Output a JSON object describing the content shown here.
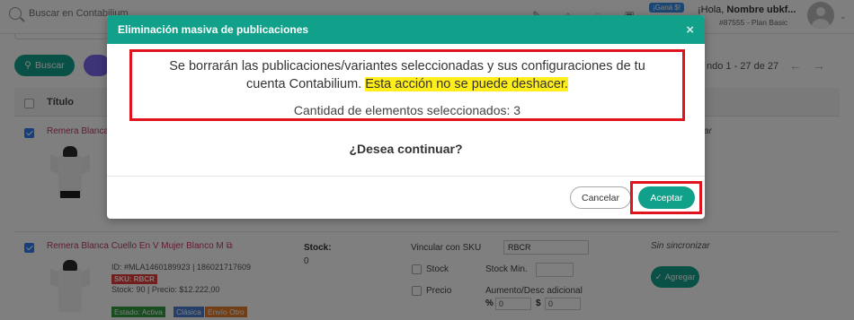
{
  "topbar": {
    "search_placeholder": "Buscar en Contabilium",
    "promo_badge": "¡Ganá $!",
    "greeting_prefix": "¡Hola, ",
    "greeting_name": "Nombre ubkf...",
    "plan_info": "#87555 - Plan Basic"
  },
  "toolbar": {
    "search_button": "Buscar",
    "pagination": "ndo 1 - 27 de 27"
  },
  "table": {
    "title_header": "Título",
    "rows": [
      {
        "title": "Remera Blanca",
        "checked": true,
        "sync_status": "zar"
      },
      {
        "title": "Remera Blanca Cuello En V Mujer Blanco M",
        "checked": true,
        "id_line": "ID: #MLA1460189923 | 186021717609",
        "sku": "SKU: RBCR",
        "stock_price": "Stock: 90 | Precio: $12.222,00",
        "tags": [
          "Estado: Activa",
          "Clásica",
          "Envío Otro"
        ],
        "stock_label": "Stock:",
        "stock_value": "0",
        "link_sku_label": "Vincular con SKU",
        "link_sku_value": "RBCR",
        "option_stock": "Stock",
        "option_price": "Precio",
        "stock_min_label": "Stock Min.",
        "adjust_label": "Aumento/Desc adicional",
        "pct_symbol": "%",
        "pct_value": "0",
        "money_symbol": "$",
        "money_value": "0",
        "sync_status": "Sin sincronizar",
        "add_button": "Agregar"
      }
    ]
  },
  "modal": {
    "title": "Eliminación masiva de publicaciones",
    "close_symbol": "×",
    "warning_line1": "Se borrarán las publicaciones/variantes seleccionadas y sus configuraciones de tu",
    "warning_line2_plain": "cuenta Contabilium. ",
    "warning_line2_highlight": "Esta acción no se puede deshacer.",
    "count_text": "Cantidad de elementos seleccionados: 3",
    "question": "¿Desea continuar?",
    "cancel_button": "Cancelar",
    "accept_button": "Aceptar"
  },
  "colors": {
    "accent": "#11a18a",
    "highlight": "#ffee1a",
    "annotation_red": "#e0141e",
    "overlay": "rgba(0,0,0,0.5)"
  }
}
